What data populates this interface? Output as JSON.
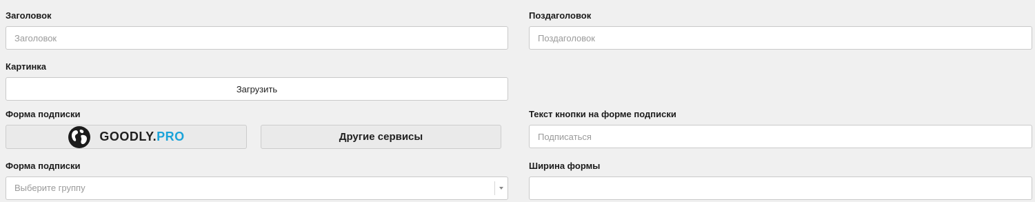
{
  "title_field": {
    "label": "Заголовок",
    "placeholder": "Заголовок",
    "value": ""
  },
  "subtitle_field": {
    "label": "Поздаголовок",
    "placeholder": "Поздаголовок",
    "value": ""
  },
  "image_field": {
    "label": "Картинка",
    "button_label": "Загрузить"
  },
  "subscription_form": {
    "label": "Форма подписки",
    "services": {
      "goodly": {
        "name_main": "GOODLY.",
        "name_accent": "PRO",
        "icon": "globe-icon",
        "accent_color": "#1aa3d9"
      },
      "other": {
        "label": "Другие сервисы"
      }
    }
  },
  "button_text_field": {
    "label": "Текст кнопки на форме подписки",
    "placeholder": "Подписаться",
    "value": ""
  },
  "group_select": {
    "label": "Форма подписки",
    "selected": "Выберите группу",
    "icon": "chevron-down-icon"
  },
  "form_width_field": {
    "label": "Ширина формы",
    "value": ""
  },
  "colors": {
    "background": "#f0f0f0",
    "input_border": "#c9c9c9",
    "placeholder": "#9a9a9a",
    "accent": "#1aa3d9"
  }
}
